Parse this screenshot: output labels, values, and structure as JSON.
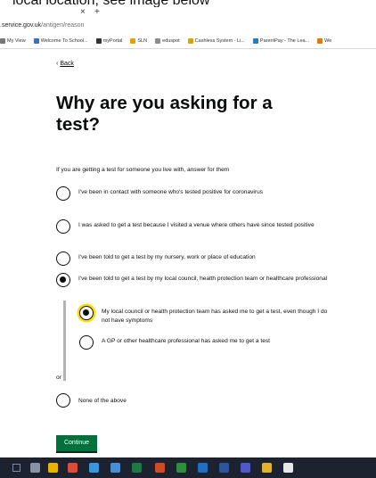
{
  "browser": {
    "top_caption": "local location, see image below",
    "tab_close": "×",
    "tab_new": "+",
    "address": ".service.gov.uk/antigen/reason",
    "address_domain": ".service.gov.uk",
    "address_path": "/antigen/reason",
    "bookmarks": [
      {
        "label": "My View",
        "icon": "person-icon",
        "color": "#777777"
      },
      {
        "label": "Welcome To School...",
        "icon": "school-icon",
        "color": "#3a6fbf"
      },
      {
        "label": "myPortal",
        "icon": "portal-icon",
        "color": "#333333"
      },
      {
        "label": "SLN",
        "icon": "sln-icon",
        "color": "#e5a100"
      },
      {
        "label": "eduspot",
        "icon": "eduspot-icon",
        "color": "#8c8c8c"
      },
      {
        "label": "Cashless System - Li...",
        "icon": "cashless-icon",
        "color": "#d7a400"
      },
      {
        "label": "ParentPay - The Lea...",
        "icon": "parentpay-icon",
        "color": "#2a79c9"
      },
      {
        "label": "We",
        "icon": "we-icon",
        "color": "#e07b00"
      }
    ]
  },
  "page": {
    "back_label": "Back",
    "title": "Why are you asking for a test?",
    "hint": "If you are getting a test for someone you live with, answer for them",
    "options": [
      {
        "label": "I've been in contact with someone who's tested positive for coronavirus",
        "checked": false
      },
      {
        "label": "I was asked to get a test because I visited a venue where others have since tested positive",
        "checked": false
      },
      {
        "label": "I've been told to get a test by my nursery, work or place of education",
        "checked": false
      },
      {
        "label": "I've been told to get a test by my local council, health protection team or healthcare professional",
        "checked": true
      }
    ],
    "sub_options": [
      {
        "label": "My local council or health protection team has asked me to get a test, even though I do not have symptoms",
        "checked": true
      },
      {
        "label": "A GP or other healthcare professional has asked me to get a test",
        "checked": false
      }
    ],
    "or_label": "or",
    "none_option": {
      "label": "None of the above",
      "checked": false
    },
    "continue_label": "Continue"
  },
  "taskbar": {
    "icons": [
      {
        "name": "task-view-icon",
        "color": "#8a93a6"
      },
      {
        "name": "file-explorer-icon",
        "color": "#e8b400"
      },
      {
        "name": "chrome-icon",
        "color": "#dd4b39"
      },
      {
        "name": "edge-icon",
        "color": "#3a96dd"
      },
      {
        "name": "people-icon",
        "color": "#4a8fd6"
      },
      {
        "name": "excel-icon",
        "color": "#1d7a45"
      },
      {
        "name": "powerpoint-icon",
        "color": "#d04a24"
      },
      {
        "name": "project-icon",
        "color": "#2f8f3a"
      },
      {
        "name": "outlook-icon",
        "color": "#1f6fc4"
      },
      {
        "name": "word-icon",
        "color": "#2b579a"
      },
      {
        "name": "teams-icon",
        "color": "#5059c9"
      },
      {
        "name": "app-yellow-icon",
        "color": "#e0b32e"
      },
      {
        "name": "app-white-icon",
        "color": "#e8e8e8"
      }
    ]
  }
}
